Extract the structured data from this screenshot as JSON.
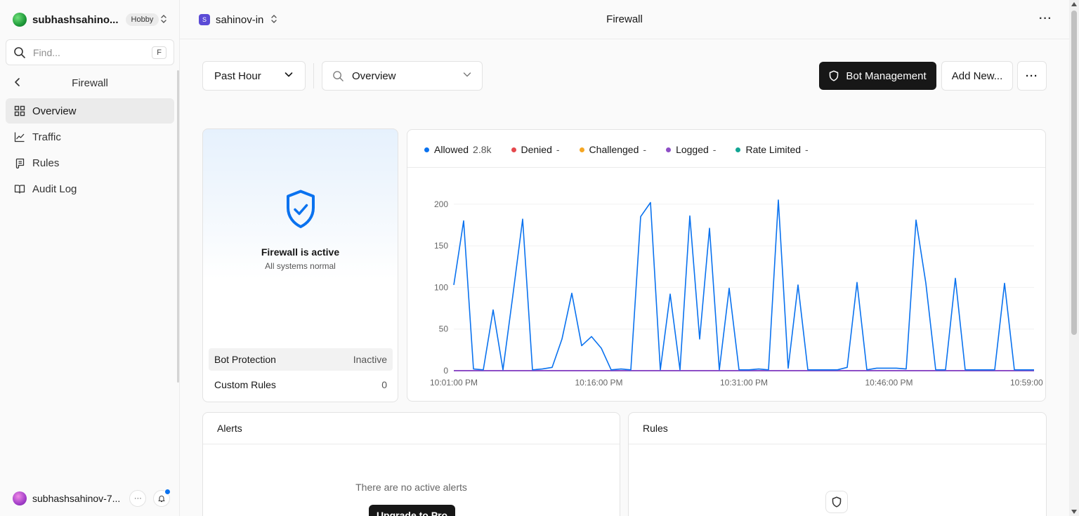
{
  "sidebar": {
    "team_name": "subhashsahino...",
    "plan_badge": "Hobby",
    "find_placeholder": "Find...",
    "find_shortcut": "F",
    "section_title": "Firewall",
    "items": [
      {
        "label": "Overview",
        "icon": "grid-icon",
        "active": true
      },
      {
        "label": "Traffic",
        "icon": "line-chart-icon",
        "active": false
      },
      {
        "label": "Rules",
        "icon": "scroll-icon",
        "active": false
      },
      {
        "label": "Audit Log",
        "icon": "book-icon",
        "active": false
      }
    ],
    "user_name": "subhashsahinov-7...",
    "user_more": "···"
  },
  "topbar": {
    "project_initial": "S",
    "project_name": "sahinov-in",
    "title": "Firewall",
    "more": "···"
  },
  "controls": {
    "time_range": "Past Hour",
    "view_placeholder": "Overview",
    "bot_button": "Bot Management",
    "add_button": "Add New...",
    "more": "···"
  },
  "status": {
    "title": "Firewall is active",
    "subtitle": "All systems normal",
    "rows": [
      {
        "label": "Bot Protection",
        "value": "Inactive"
      },
      {
        "label": "Custom Rules",
        "value": "0"
      }
    ]
  },
  "legend": [
    {
      "name": "Allowed",
      "value": "2.8k",
      "color": "#0a72ef"
    },
    {
      "name": "Denied",
      "value": "-",
      "color": "#e5484d"
    },
    {
      "name": "Challenged",
      "value": "-",
      "color": "#f5a623"
    },
    {
      "name": "Logged",
      "value": "-",
      "color": "#8e4ec6"
    },
    {
      "name": "Rate Limited",
      "value": "-",
      "color": "#12a594"
    }
  ],
  "chart_data": {
    "type": "line",
    "x_tick_labels": [
      "10:01:00 PM",
      "10:16:00 PM",
      "10:31:00 PM",
      "10:46:00 PM",
      "10:59:00 PM"
    ],
    "yticks": [
      0,
      50,
      100,
      150,
      200
    ],
    "ylim": [
      0,
      210
    ],
    "grid": true,
    "series": [
      {
        "name": "Allowed",
        "color": "#0a72ef",
        "values": [
          103,
          180,
          2,
          1,
          73,
          1,
          90,
          182,
          1,
          2,
          4,
          38,
          93,
          30,
          41,
          27,
          1,
          2,
          1,
          185,
          202,
          1,
          92,
          1,
          186,
          38,
          171,
          1,
          99,
          1,
          1,
          2,
          1,
          205,
          3,
          103,
          1,
          1,
          1,
          1,
          4,
          106,
          1,
          3,
          3,
          3,
          2,
          181,
          105,
          1,
          1,
          111,
          1,
          1,
          1,
          1,
          105,
          1,
          1,
          1
        ]
      },
      {
        "name": "Denied",
        "color": "#e5484d",
        "values": []
      },
      {
        "name": "Challenged",
        "color": "#f5a623",
        "values": []
      },
      {
        "name": "Logged",
        "color": "#8e4ec6",
        "values": []
      },
      {
        "name": "Rate Limited",
        "color": "#12a594",
        "values": []
      }
    ]
  },
  "alerts": {
    "title": "Alerts",
    "empty": "There are no active alerts",
    "upgrade": "Upgrade to Pro"
  },
  "rules": {
    "title": "Rules"
  }
}
